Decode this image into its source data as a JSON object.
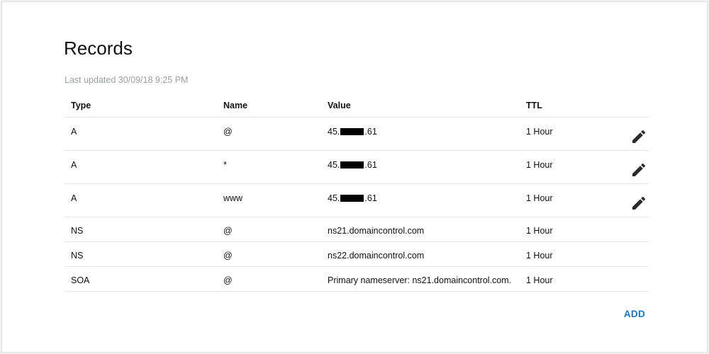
{
  "page": {
    "title": "Records",
    "last_updated": "Last updated 30/09/18 9:25 PM"
  },
  "table": {
    "headers": {
      "type": "Type",
      "name": "Name",
      "value": "Value",
      "ttl": "TTL"
    },
    "rows": [
      {
        "type": "A",
        "name": "@",
        "value_prefix": "45.",
        "value_suffix": ".61",
        "redacted": true,
        "ttl": "1 Hour",
        "editable": true
      },
      {
        "type": "A",
        "name": "*",
        "value_prefix": "45.",
        "value_suffix": ".61",
        "redacted": true,
        "ttl": "1 Hour",
        "editable": true
      },
      {
        "type": "A",
        "name": "www",
        "value_prefix": "45.",
        "value_suffix": ".61",
        "redacted": true,
        "ttl": "1 Hour",
        "editable": true
      },
      {
        "type": "NS",
        "name": "@",
        "value": "ns21.domaincontrol.com",
        "ttl": "1 Hour",
        "editable": false
      },
      {
        "type": "NS",
        "name": "@",
        "value": "ns22.domaincontrol.com",
        "ttl": "1 Hour",
        "editable": false
      },
      {
        "type": "SOA",
        "name": "@",
        "value": "Primary nameserver: ns21.domaincontrol.com.",
        "ttl": "1 Hour",
        "editable": false
      }
    ]
  },
  "actions": {
    "add_label": "ADD",
    "edit_icon": "pencil-icon"
  },
  "colors": {
    "accent": "#1976d2",
    "muted_text": "#9a9ea4",
    "divider": "#e6e6e6",
    "icon": "#2b2b2b"
  }
}
